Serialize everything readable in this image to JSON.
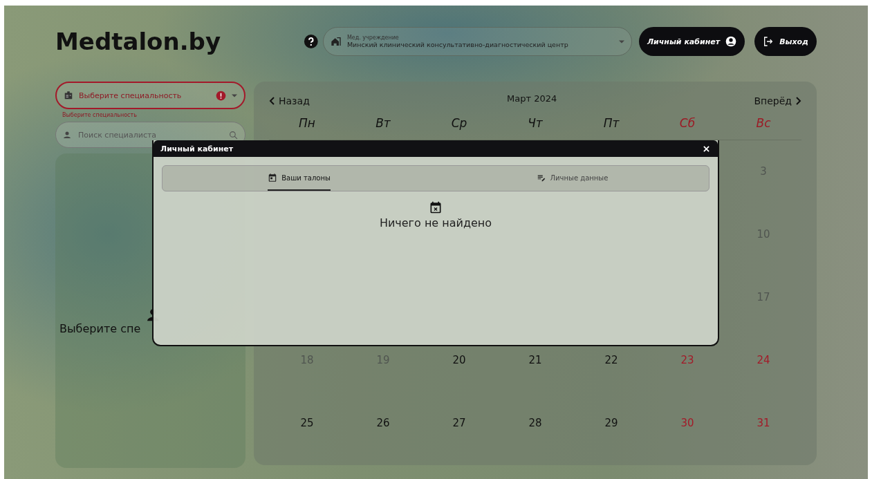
{
  "logo": "Medtalon.by",
  "institution": {
    "label": "Мед. учреждение",
    "value": "Минский клинический консультативно-диагностический центр"
  },
  "buttons": [
    {
      "kind": "cabinet",
      "label": "Личный кабинет"
    },
    {
      "kind": "logout",
      "label": "Выход"
    }
  ],
  "specialty_select": {
    "placeholder": "Выберите специальность",
    "error": true,
    "error_text": "Выберите специальность"
  },
  "search": {
    "placeholder": "Поиск специалиста"
  },
  "empty_panel": {
    "text": "Выберите спе"
  },
  "calendar": {
    "prev": "Назад",
    "title": "Март 2024",
    "next": "Вперёд",
    "weekdays": [
      {
        "label": "Пн",
        "weekend": false
      },
      {
        "label": "Вт",
        "weekend": false
      },
      {
        "label": "Ср",
        "weekend": false
      },
      {
        "label": "Чт",
        "weekend": false
      },
      {
        "label": "Пт",
        "weekend": false
      },
      {
        "label": "Сб",
        "weekend": true
      },
      {
        "label": "Вс",
        "weekend": true
      }
    ],
    "weeks": [
      [
        {
          "day": "3",
          "past": true
        }
      ],
      [
        {
          "day": "10",
          "past": true
        }
      ],
      [
        {
          "day": "17",
          "past": true
        }
      ],
      [
        {
          "day": "18",
          "weekend": false,
          "past": true
        },
        {
          "day": "19",
          "weekend": false,
          "past": true
        },
        {
          "day": "20",
          "weekend": false,
          "past": false
        },
        {
          "day": "21",
          "weekend": false,
          "past": false
        },
        {
          "day": "22",
          "weekend": false,
          "past": false
        },
        {
          "day": "23",
          "weekend": true,
          "past": false
        },
        {
          "day": "24",
          "weekend": true,
          "past": false
        }
      ],
      [
        {
          "day": "25",
          "weekend": false,
          "past": false
        },
        {
          "day": "26",
          "weekend": false,
          "past": false
        },
        {
          "day": "27",
          "weekend": false,
          "past": false
        },
        {
          "day": "28",
          "weekend": false,
          "past": false
        },
        {
          "day": "29",
          "weekend": false,
          "past": false
        },
        {
          "day": "30",
          "weekend": true,
          "past": false
        },
        {
          "day": "31",
          "weekend": true,
          "past": false
        }
      ]
    ]
  },
  "modal": {
    "title": "Личный кабинет",
    "tabs": [
      {
        "kind": "tickets",
        "label": "Ваши талоны",
        "selected": true
      },
      {
        "kind": "profile",
        "label": "Личные данные",
        "selected": false
      }
    ],
    "empty_text": "Ничего не найдено"
  }
}
